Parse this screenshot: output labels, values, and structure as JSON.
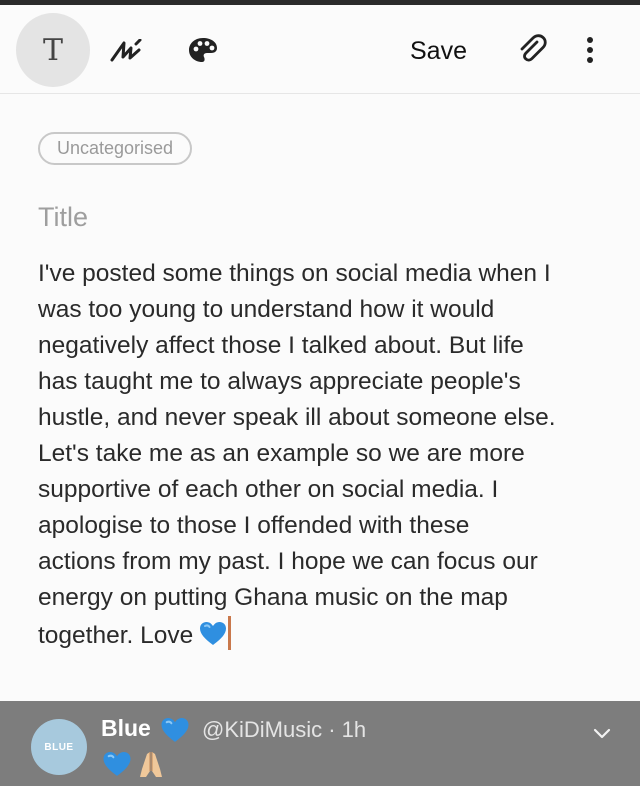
{
  "toolbar": {
    "text_mode_glyph": "T",
    "save_label": "Save",
    "icons": [
      "text-format-icon",
      "pen-icon",
      "palette-icon",
      "paperclip-icon",
      "more-vertical-icon"
    ]
  },
  "note": {
    "category": "Uncategorised",
    "title_placeholder": "Title",
    "body_lines": [
      "I've posted some things on social media when I",
      "was too young to understand how it would",
      "negatively affect those I talked about. But life",
      "has taught me to always appreciate people's",
      "hustle, and never speak ill about someone else.",
      "Let's take me as an example so we are more",
      "supportive of each other on social media. I",
      "apologise to those I offended with these",
      "actions from my past. I hope we can focus our",
      "energy on putting Ghana music on the map",
      "together. Love"
    ],
    "ending_emoji": "blue-heart"
  },
  "tweet": {
    "avatar_text": "BLUE",
    "display_name": "Blue",
    "name_emoji": "blue-heart",
    "handle_time": "@KiDiMusic · 1h",
    "content_emojis": [
      "blue-heart",
      "folded-hands"
    ]
  },
  "colors": {
    "accent_cursor": "#c9784b",
    "heart_blue": "#2f8fe0",
    "tweet_bar": "#7d7d7d"
  }
}
